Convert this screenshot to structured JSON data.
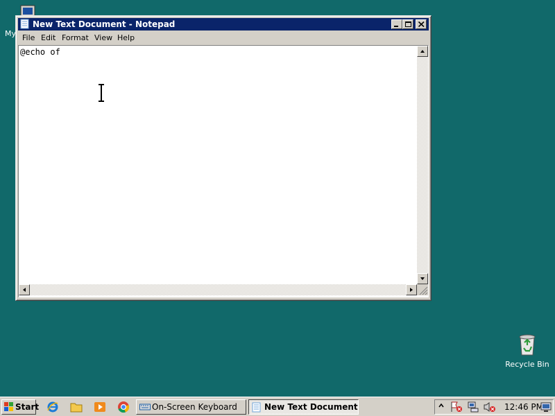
{
  "desktop": {
    "my_computer_label": "My",
    "recycle_bin_label": "Recycle Bin"
  },
  "window": {
    "title": "New Text Document - Notepad",
    "menu": [
      "File",
      "Edit",
      "Format",
      "View",
      "Help"
    ],
    "content": "@echo of"
  },
  "taskbar": {
    "start_label": "Start",
    "tasks": [
      {
        "label": "On-Screen Keyboard",
        "active": false
      },
      {
        "label": "New Text Document ...",
        "active": true
      }
    ],
    "clock": "12:46 PM"
  },
  "icons": {
    "quick_launch": [
      "internet-explorer-icon",
      "explorer-folder-icon",
      "media-player-icon",
      "chrome-icon"
    ],
    "tray": [
      "expand-arrow-icon",
      "security-alert-icon",
      "network-icon",
      "volume-muted-icon",
      "display-icon"
    ]
  },
  "colors": {
    "desktop": "#11696a",
    "title_bar": "#0a246a",
    "chrome": "#d4d0c8"
  }
}
